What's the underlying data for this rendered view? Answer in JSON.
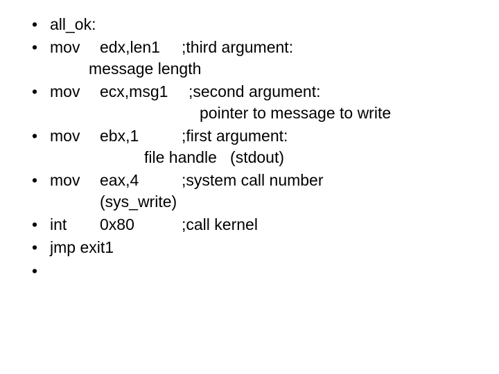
{
  "lines": {
    "l1": "all_ok:",
    "l2a_mn": "mov",
    "l2a_ops": "edx,len1",
    "l2a_cmt": ";third argument:",
    "l2b": "message length",
    "l3a_mn": "mov",
    "l3a_ops": "ecx,msg1",
    "l3a_cmt": ";second argument:",
    "l3b": "pointer to message to write",
    "l4a_mn": "mov",
    "l4a_ops": "ebx,1",
    "l4a_cmt": ";first argument:",
    "l4b_a": "file handle",
    "l4b_b": "(stdout)",
    "l5a_mn": "mov",
    "l5a_ops": "eax,4",
    "l5a_cmt": ";system call number",
    "l5b": "(sys_write)",
    "l6_mn": "int",
    "l6_ops": "0x80",
    "l6_cmt": ";call kernel",
    "l7": "jmp exit1"
  }
}
